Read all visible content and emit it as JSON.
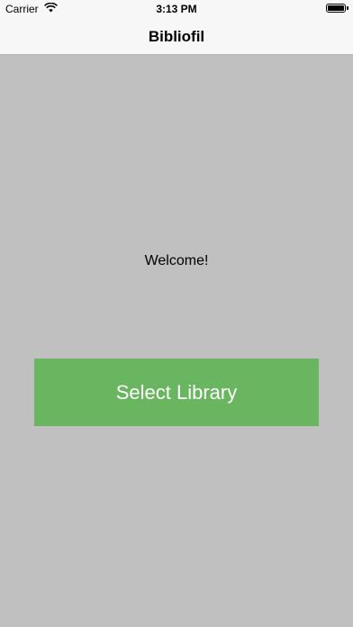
{
  "status_bar": {
    "carrier": "Carrier",
    "time": "3:13 PM",
    "icons": [
      "wifi-icon",
      "battery-icon"
    ]
  },
  "nav": {
    "title": "Bibliofil"
  },
  "main": {
    "welcome": "Welcome!",
    "select_button_label": "Select Library"
  },
  "colors": {
    "background": "#c0c0c0",
    "nav_background": "#f7f7f7",
    "button_green": "#6ab560",
    "button_text": "#ffffff"
  }
}
